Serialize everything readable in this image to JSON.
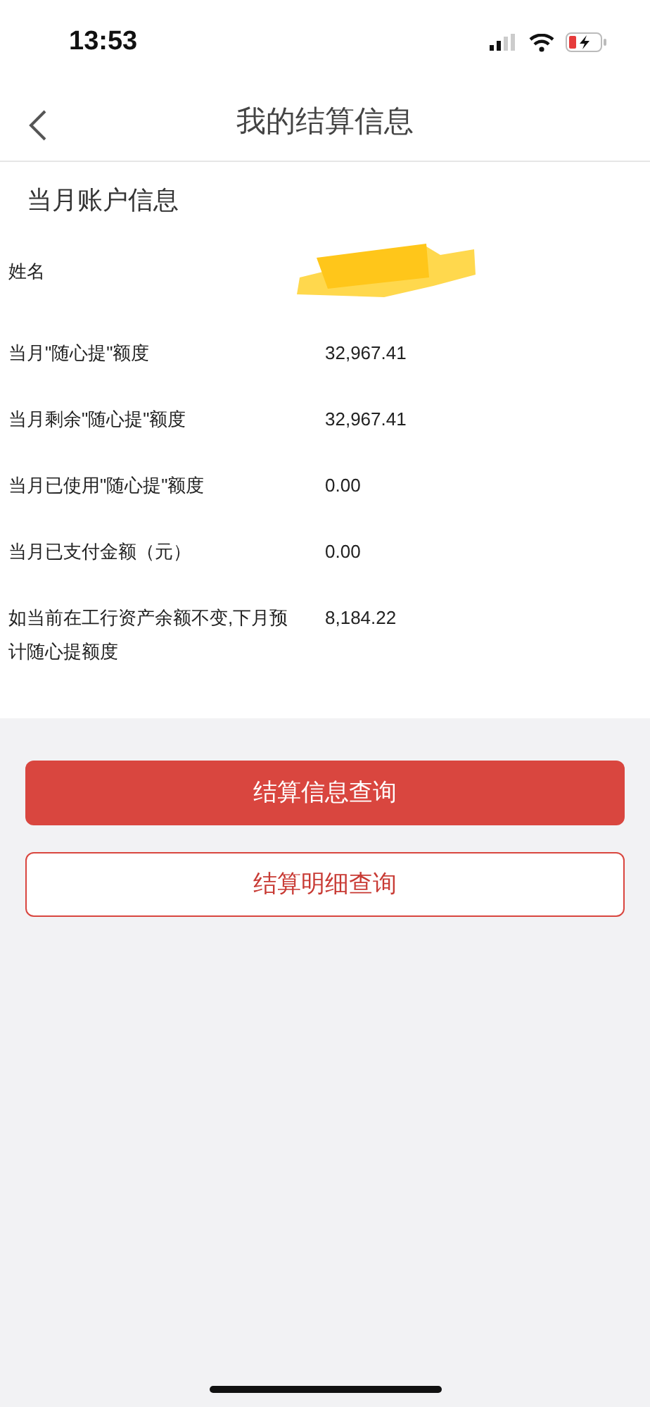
{
  "status_bar": {
    "time": "13:53"
  },
  "nav": {
    "title": "我的结算信息"
  },
  "section": {
    "title": "当月账户信息"
  },
  "rows": [
    {
      "kind": "redacted",
      "label": "姓名"
    },
    {
      "kind": "value",
      "label": "当月\"随心提\"额度",
      "value": "32,967.41"
    },
    {
      "kind": "value",
      "label": "当月剩余\"随心提\"额度",
      "value": "32,967.41"
    },
    {
      "kind": "value",
      "label": "当月已使用\"随心提\"额度",
      "value": "0.00"
    },
    {
      "kind": "value",
      "label": "当月已支付金额（元）",
      "value": "0.00"
    },
    {
      "kind": "value",
      "label": "如当前在工行资产余额不变,下月预计随心提额度",
      "value": "8,184.22"
    }
  ],
  "buttons": [
    {
      "kind": "primary",
      "label": "结算信息查询"
    },
    {
      "kind": "outline",
      "label": "结算明细查询"
    }
  ]
}
